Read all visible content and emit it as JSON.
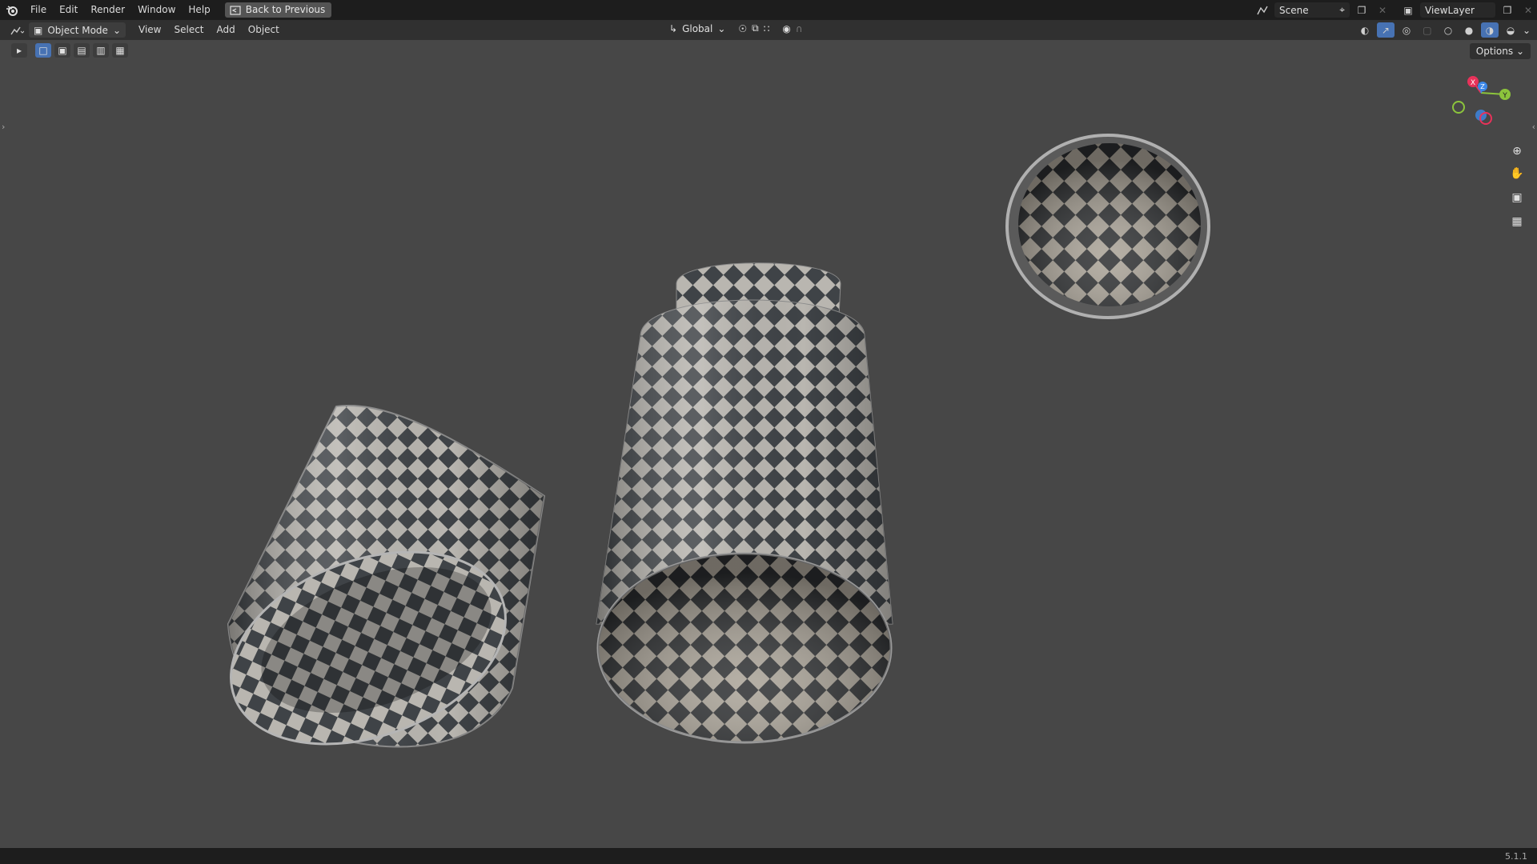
{
  "menu": {
    "items": [
      "File",
      "Edit",
      "Render",
      "Window",
      "Help"
    ],
    "back_button": "Back to Previous"
  },
  "top_right": {
    "scene_name": "Scene",
    "view_layer": "ViewLayer"
  },
  "header": {
    "mode": "Object Mode",
    "menus": [
      "View",
      "Select",
      "Add",
      "Object"
    ],
    "transform_orientation": "Global",
    "options_label": "Options"
  },
  "gizmo": {
    "x_label": "X",
    "y_label": "Y",
    "z_label": "Z"
  },
  "status": {
    "version": "5.1.1"
  },
  "colors": {
    "accent": "#4772b3",
    "axis_x": "#e8325a",
    "axis_y": "#8cc43c",
    "axis_z": "#3c88e8"
  }
}
